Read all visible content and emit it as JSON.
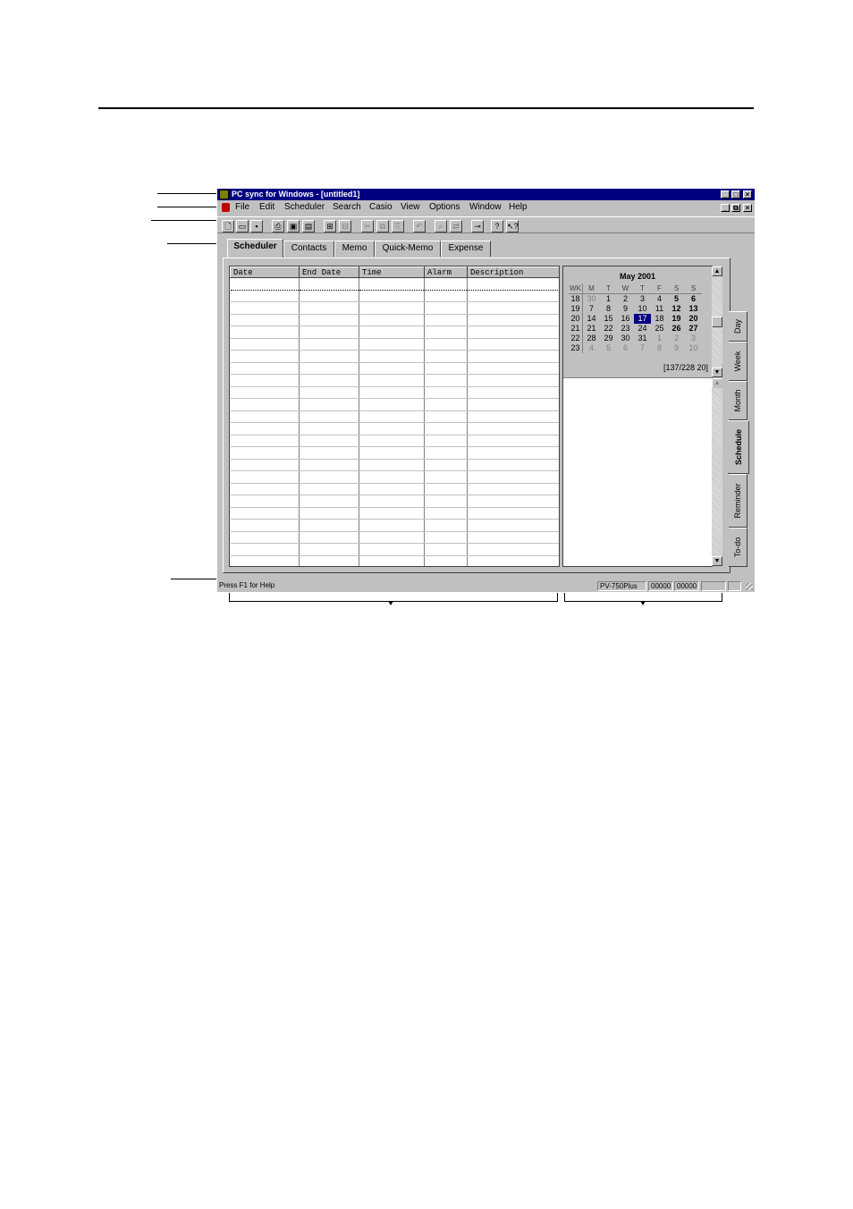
{
  "window": {
    "title": "PC sync for Windows - [untitled1]",
    "caption_buttons": [
      "_",
      "□",
      "×"
    ],
    "doc_caption_buttons": [
      "_",
      "⧉",
      "×"
    ]
  },
  "menu": [
    "File",
    "Edit",
    "Scheduler",
    "Search",
    "Casio",
    "View",
    "Options",
    "Window",
    "Help"
  ],
  "toolbar": [
    {
      "icon": "new-file-icon",
      "glyph": "🗋"
    },
    {
      "icon": "open-folder-icon",
      "glyph": "▭"
    },
    {
      "icon": "save-icon",
      "glyph": "▪"
    },
    {
      "icon": "print-icon",
      "glyph": "⎙"
    },
    {
      "icon": "send-icon",
      "glyph": "▣"
    },
    {
      "icon": "receive-icon",
      "glyph": "▤"
    },
    {
      "icon": "import-icon",
      "glyph": "⊞"
    },
    {
      "icon": "export-icon",
      "glyph": "⊟"
    },
    {
      "icon": "cut-icon",
      "glyph": "✂"
    },
    {
      "icon": "copy-icon",
      "glyph": "⧉"
    },
    {
      "icon": "paste-icon",
      "glyph": "⎘"
    },
    {
      "icon": "undo-icon",
      "glyph": "↶"
    },
    {
      "icon": "find-icon",
      "glyph": "⌕"
    },
    {
      "icon": "replace-icon",
      "glyph": "⇄"
    },
    {
      "icon": "key-icon",
      "glyph": "⊸"
    },
    {
      "icon": "help-icon",
      "glyph": "?"
    },
    {
      "icon": "context-help-icon",
      "glyph": "↖?"
    }
  ],
  "tabs": [
    "Scheduler",
    "Contacts",
    "Memo",
    "Quick-Memo",
    "Expense"
  ],
  "active_tab": "Scheduler",
  "grid": {
    "columns": [
      "Date",
      "End Date",
      "Time",
      "Alarm",
      "Description"
    ],
    "row_count": 24
  },
  "calendar": {
    "month_title": "May 2001",
    "header": [
      "WK",
      "M",
      "T",
      "W",
      "T",
      "F",
      "S",
      "S"
    ],
    "weeks": [
      {
        "wk": "18",
        "days": [
          "30",
          "1",
          "2",
          "3",
          "4",
          "5",
          "6"
        ]
      },
      {
        "wk": "19",
        "days": [
          "7",
          "8",
          "9",
          "10",
          "11",
          "12",
          "13"
        ]
      },
      {
        "wk": "20",
        "days": [
          "14",
          "15",
          "16",
          "17",
          "18",
          "19",
          "20"
        ]
      },
      {
        "wk": "21",
        "days": [
          "21",
          "22",
          "23",
          "24",
          "25",
          "26",
          "27"
        ]
      },
      {
        "wk": "22",
        "days": [
          "28",
          "29",
          "30",
          "31",
          "1",
          "2",
          "3"
        ]
      },
      {
        "wk": "23",
        "days": [
          "4",
          "5",
          "6",
          "7",
          "8",
          "9",
          "10"
        ]
      }
    ],
    "selected_day": "17",
    "day_count": "[137/228 20]"
  },
  "side_tabs": [
    "Day",
    "Week",
    "Month",
    "Schedule",
    "Reminder",
    "To-do"
  ],
  "active_side_tab": "Schedule",
  "status": {
    "help_text": "Press F1 for Help",
    "model": "PV-750Plus",
    "counter1": "00000",
    "counter2": "00000"
  }
}
